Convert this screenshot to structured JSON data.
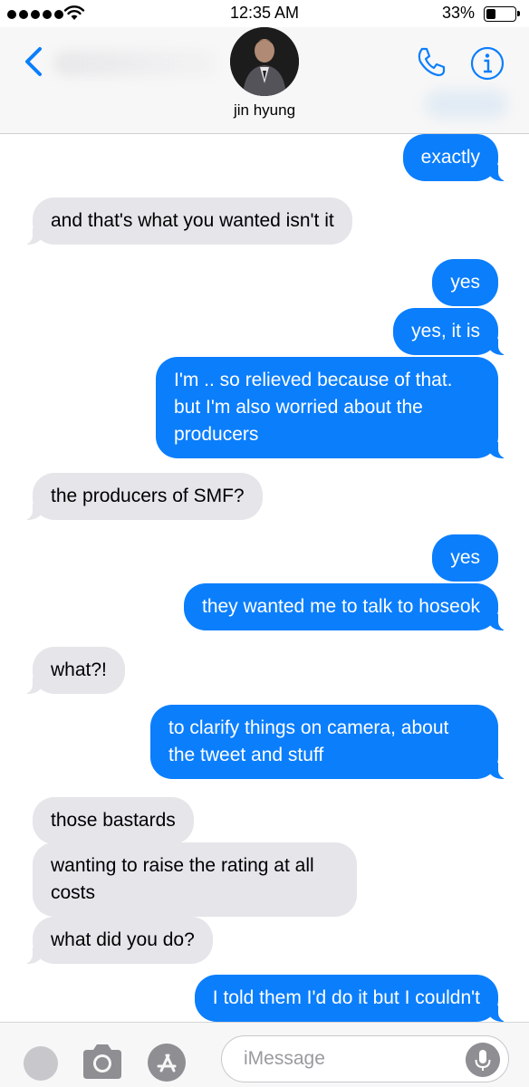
{
  "status_bar": {
    "time": "12:35 AM",
    "battery_percent_label": "33%",
    "battery_level": 0.33
  },
  "header": {
    "contact_name": "jin hyung"
  },
  "messages": [
    {
      "text": "exactly",
      "direction": "sent"
    },
    {
      "text": "and that's what you wanted isn't it",
      "direction": "received"
    },
    {
      "text": "yes",
      "direction": "sent"
    },
    {
      "text": "yes, it is",
      "direction": "sent"
    },
    {
      "text": "I'm .. so relieved because of that. but I'm also worried about the producers",
      "direction": "sent"
    },
    {
      "text": "the producers of SMF?",
      "direction": "received"
    },
    {
      "text": "yes",
      "direction": "sent"
    },
    {
      "text": "they wanted me to talk to hoseok",
      "direction": "sent"
    },
    {
      "text": "what?!",
      "direction": "received"
    },
    {
      "text": "to clarify things on camera, about the tweet and stuff",
      "direction": "sent"
    },
    {
      "text": "those bastards",
      "direction": "received"
    },
    {
      "text": "wanting to raise the rating at all costs",
      "direction": "received"
    },
    {
      "text": "what did you do?",
      "direction": "received"
    },
    {
      "text": "I told them I'd do it but I couldn't",
      "direction": "sent"
    }
  ],
  "input_bar": {
    "placeholder": "iMessage"
  },
  "colors": {
    "sent_bubble": "#0b7efc",
    "received_bubble": "#e5e5ea",
    "accent": "#0b7efc"
  },
  "icons": [
    "signal-dots-icon",
    "wifi-icon",
    "battery-icon",
    "back-chevron-icon",
    "phone-icon",
    "info-icon",
    "camera-icon",
    "app-store-icon",
    "microphone-icon"
  ]
}
